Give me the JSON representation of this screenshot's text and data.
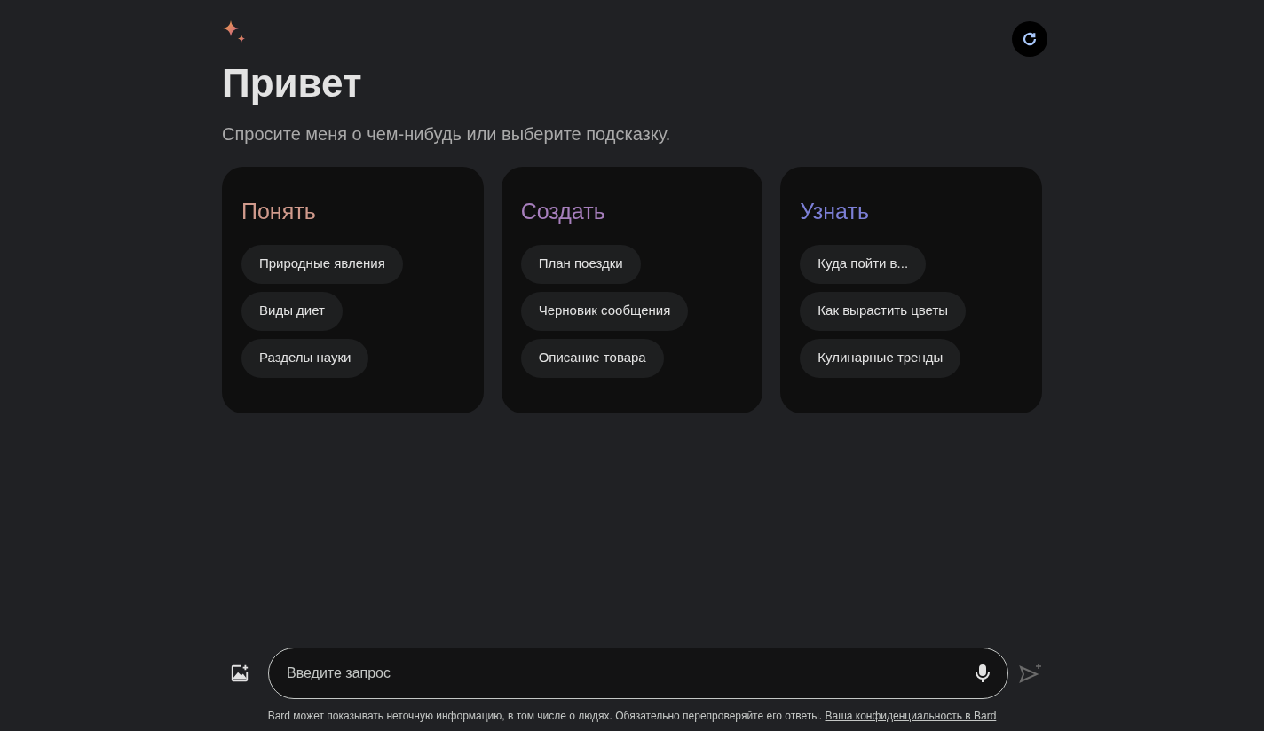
{
  "greeting": "Привет",
  "subtitle": "Спросите меня о чем-нибудь или выберите подсказку.",
  "cards": [
    {
      "title": "Понять",
      "color": "#d09a8c",
      "prompts": [
        "Природные явления",
        "Виды диет",
        "Разделы науки"
      ]
    },
    {
      "title": "Создать",
      "color": "#a77fbd",
      "prompts": [
        "План поездки",
        "Черновик сообщения",
        "Описание товара"
      ]
    },
    {
      "title": "Узнать",
      "color": "#7c7fd6",
      "prompts": [
        "Куда пойти в...",
        "Как вырастить цветы",
        "Кулинарные тренды"
      ]
    }
  ],
  "input": {
    "placeholder": "Введите запрос"
  },
  "disclaimer": {
    "text": "Bard может показывать неточную информацию, в том числе о людях. Обязательно перепроверяйте его ответы.",
    "link": "Ваша конфиденциальность в Bard"
  }
}
